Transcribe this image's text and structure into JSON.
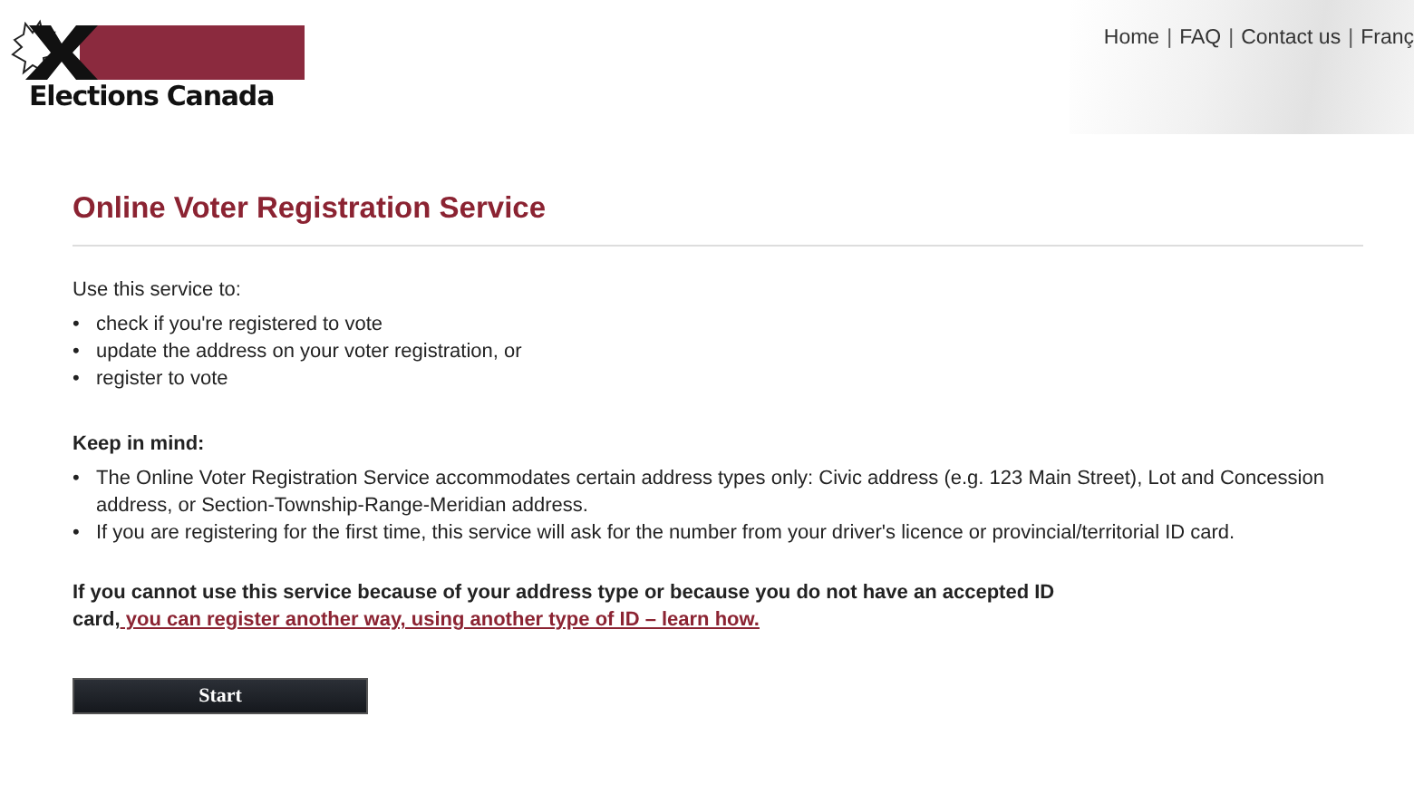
{
  "header": {
    "logo_text": "Elections Canada",
    "nav": [
      {
        "label": "Home"
      },
      {
        "label": "FAQ"
      },
      {
        "label": "Contact us"
      },
      {
        "label": "Franç"
      }
    ],
    "separator": "|"
  },
  "bullet": "•",
  "title": "Online Voter Registration Service",
  "intro": "Use this service to:",
  "uses": [
    "check if you're registered to vote",
    "update the address on your voter registration, or",
    "register to vote"
  ],
  "keep_heading": "Keep in mind:",
  "notes": [
    "The Online Voter Registration Service accommodates certain address types only: Civic address (e.g. 123 Main Street), Lot and Concession address, or Section-Township-Range-Meridian address.",
    "If you are registering for the first time, this service will ask for the number from your driver's licence or provincial/territorial ID card."
  ],
  "alternative": {
    "text": "If you cannot use this service because of your address type or because you do not have an accepted ID card,",
    "link": " you can register another way, using another type of ID – learn how."
  },
  "start_button": "Start"
}
